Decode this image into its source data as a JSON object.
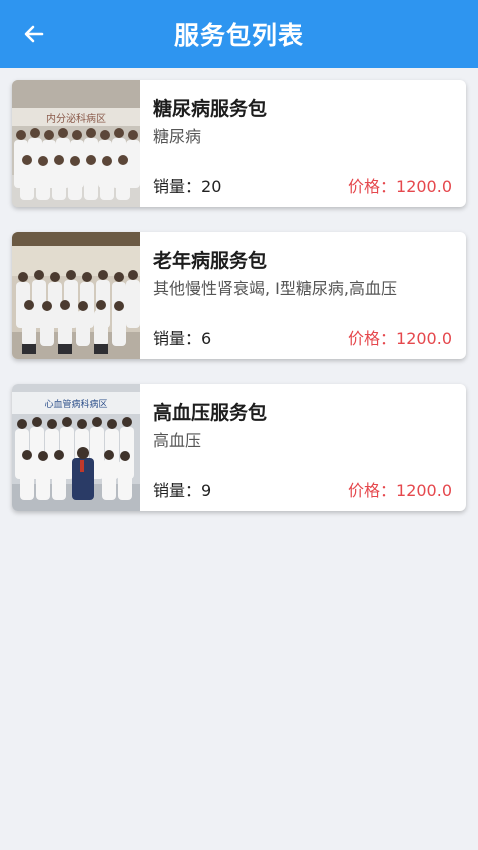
{
  "header": {
    "title": "服务包列表",
    "back_icon": "arrow-left-icon"
  },
  "colors": {
    "appbar": "#2e95f0",
    "price": "#e5484d",
    "background": "#eff1f5"
  },
  "packages": [
    {
      "name": "糖尿病服务包",
      "diseases": "糖尿病",
      "sales_label": "销量：",
      "sales": "20",
      "price_label": "价格：",
      "price": "1200.0",
      "image_banner_text": "内分泌科病区"
    },
    {
      "name": "老年病服务包",
      "diseases": "其他慢性肾衰竭, I型糖尿病,高血压",
      "sales_label": "销量：",
      "sales": "6",
      "price_label": "价格：",
      "price": "1200.0",
      "image_banner_text": ""
    },
    {
      "name": "高血压服务包",
      "diseases": "高血压",
      "sales_label": "销量：",
      "sales": "9",
      "price_label": "价格：",
      "price": "1200.0",
      "image_banner_text": "心血管病科病区"
    }
  ]
}
